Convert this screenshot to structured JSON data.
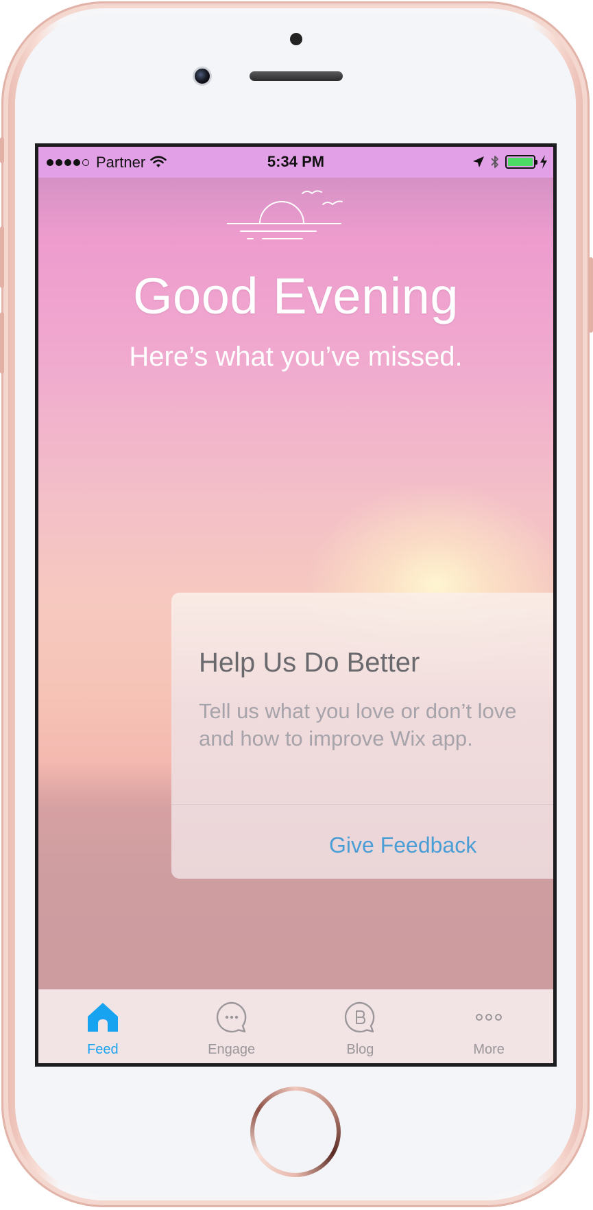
{
  "status_bar": {
    "carrier": "Partner",
    "time": "5:34 PM",
    "signal_bars_filled": 4,
    "signal_bars_total": 5,
    "battery_level": 1.0,
    "battery_color": "#4cd964"
  },
  "header": {
    "greeting": "Good Evening",
    "subtitle": "Here’s what you’ve missed.",
    "icon": "sunset-icon"
  },
  "feedback_card": {
    "title": "Help Us Do Better",
    "body": "Tell us what you love or don’t love and how to improve Wix app.",
    "action_label": "Give Feedback",
    "action_color": "#4a9ed6"
  },
  "tab_bar": {
    "active_color": "#17a3ef",
    "tabs": [
      {
        "label": "Feed",
        "icon": "home-icon",
        "active": true
      },
      {
        "label": "Engage",
        "icon": "chat-bubble-icon",
        "active": false
      },
      {
        "label": "Blog",
        "icon": "blog-icon",
        "active": false
      },
      {
        "label": "More",
        "icon": "more-dots-icon",
        "active": false
      }
    ]
  }
}
